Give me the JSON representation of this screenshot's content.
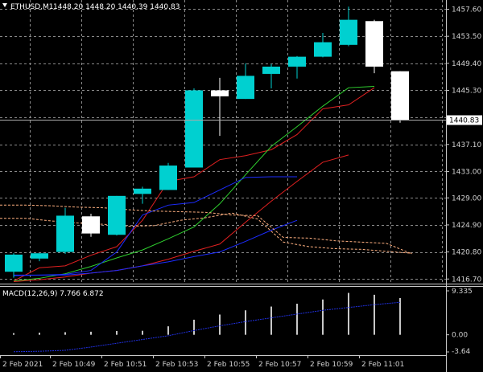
{
  "header": {
    "symbol": "ETHUSD,M1",
    "ohlc": "1448.20 1448.20 1440.39 1440.83"
  },
  "macd_header": "MACD(12,26,9) 7.766 6.872",
  "price_tag": "1440.83",
  "colors": {
    "background": "#000000",
    "grid": "#8a8a8a",
    "bull_candle": "#00d0d0",
    "bear_candle": "#ffffff",
    "ma_red": "#e02020",
    "ma_green": "#2fd02f",
    "ma_blue": "#1c2cff",
    "ma_dashed": "#ffb080",
    "macd_hist": "#c8c8c8",
    "macd_signal": "#2030e0"
  },
  "chart_data": {
    "type": "candlestick",
    "symbol": "ETHUSD",
    "timeframe": "M1",
    "price_axis": {
      "ticks": [
        1457.6,
        1453.5,
        1449.4,
        1445.3,
        1441.2,
        1437.1,
        1433.0,
        1429.0,
        1424.9,
        1420.8,
        1416.7
      ],
      "labels": [
        "1457.60",
        "1453.50",
        "1449.40",
        "1445.30",
        "",
        "1437.10",
        "1433.00",
        "1429.00",
        "1424.90",
        "1420.80",
        "1416.70"
      ],
      "range": [
        1416.0,
        1459.0
      ]
    },
    "time_axis": {
      "labels": [
        "2 Feb 2021",
        "2 Feb 10:49",
        "2 Feb 10:51",
        "2 Feb 10:53",
        "2 Feb 10:55",
        "2 Feb 10:57",
        "2 Feb 10:59",
        "2 Feb 11:01"
      ]
    },
    "candles": [
      {
        "o": 1417.8,
        "h": 1420.6,
        "l": 1416.9,
        "c": 1420.4
      },
      {
        "o": 1419.8,
        "h": 1420.6,
        "l": 1419.4,
        "c": 1420.6
      },
      {
        "o": 1420.8,
        "h": 1427.5,
        "l": 1420.5,
        "c": 1426.3
      },
      {
        "o": 1426.2,
        "h": 1426.6,
        "l": 1423.1,
        "c": 1423.6
      },
      {
        "o": 1423.4,
        "h": 1429.3,
        "l": 1423.3,
        "c": 1429.3
      },
      {
        "o": 1429.6,
        "h": 1430.7,
        "l": 1428.1,
        "c": 1430.4
      },
      {
        "o": 1430.2,
        "h": 1434.3,
        "l": 1430.2,
        "c": 1433.9
      },
      {
        "o": 1433.6,
        "h": 1445.6,
        "l": 1433.6,
        "c": 1445.3
      },
      {
        "o": 1445.3,
        "h": 1447.2,
        "l": 1438.4,
        "c": 1444.4
      },
      {
        "o": 1444.0,
        "h": 1449.4,
        "l": 1444.0,
        "c": 1447.5
      },
      {
        "o": 1447.8,
        "h": 1449.3,
        "l": 1445.6,
        "c": 1448.9
      },
      {
        "o": 1448.9,
        "h": 1450.5,
        "l": 1447.1,
        "c": 1450.4
      },
      {
        "o": 1450.4,
        "h": 1454.0,
        "l": 1450.3,
        "c": 1452.6
      },
      {
        "o": 1452.2,
        "h": 1458.0,
        "l": 1452.0,
        "c": 1456.0
      },
      {
        "o": 1455.8,
        "h": 1456.0,
        "l": 1447.9,
        "c": 1448.9
      },
      {
        "o": 1448.2,
        "h": 1448.2,
        "l": 1440.4,
        "c": 1440.8
      }
    ],
    "moving_averages": [
      {
        "color": "red",
        "values": [
          1416.4,
          1418.4,
          1418.7,
          1420.3,
          1421.6,
          1425.6,
          1431.5,
          1432.2,
          1434.8,
          1435.4,
          1436.3,
          1438.6,
          1442.5,
          1443.1,
          1445.7
        ]
      },
      {
        "color": "green",
        "values": [
          1416.4,
          1416.8,
          1417.5,
          1418.6,
          1419.9,
          1421.1,
          1422.8,
          1424.6,
          1428.1,
          1432.5,
          1436.8,
          1439.8,
          1442.9,
          1445.7,
          1445.9
        ]
      },
      {
        "color": "blue",
        "values": [
          1417.3,
          1417.3,
          1417.4,
          1418.0,
          1420.8,
          1426.4,
          1427.9,
          1428.3,
          1430.2,
          1432.1,
          1432.2,
          1432.2
        ]
      },
      {
        "color": "red",
        "values": [
          1416.3,
          1416.6,
          1417.0,
          1417.6,
          1418.0,
          1418.7,
          1419.7,
          1420.9,
          1422.0,
          1425.3,
          1428.5,
          1431.5,
          1434.4,
          1435.5
        ]
      },
      {
        "color": "blue",
        "values": [
          1417.2,
          1417.3,
          1417.3,
          1417.6,
          1418.0,
          1418.7,
          1419.3,
          1420.1,
          1420.8,
          1422.4,
          1424.1,
          1425.6
        ]
      }
    ],
    "macd": {
      "params": "12,26,9",
      "value": 7.766,
      "signal": 6.872,
      "axis_labels": [
        "9.335",
        "0.00",
        "-3.64"
      ],
      "range": [
        -3.64,
        9.335
      ],
      "histogram": [
        0.35,
        0.45,
        0.55,
        0.65,
        0.8,
        0.85,
        1.8,
        3.2,
        4.3,
        5.2,
        6.0,
        6.6,
        7.5,
        8.9,
        8.5,
        7.8
      ],
      "signal_line": [
        -3.6,
        -3.5,
        -3.3,
        -2.6,
        -1.8,
        -1.0,
        -0.2,
        0.9,
        1.9,
        2.8,
        3.6,
        4.4,
        5.2,
        5.8,
        6.4,
        6.9
      ]
    }
  }
}
